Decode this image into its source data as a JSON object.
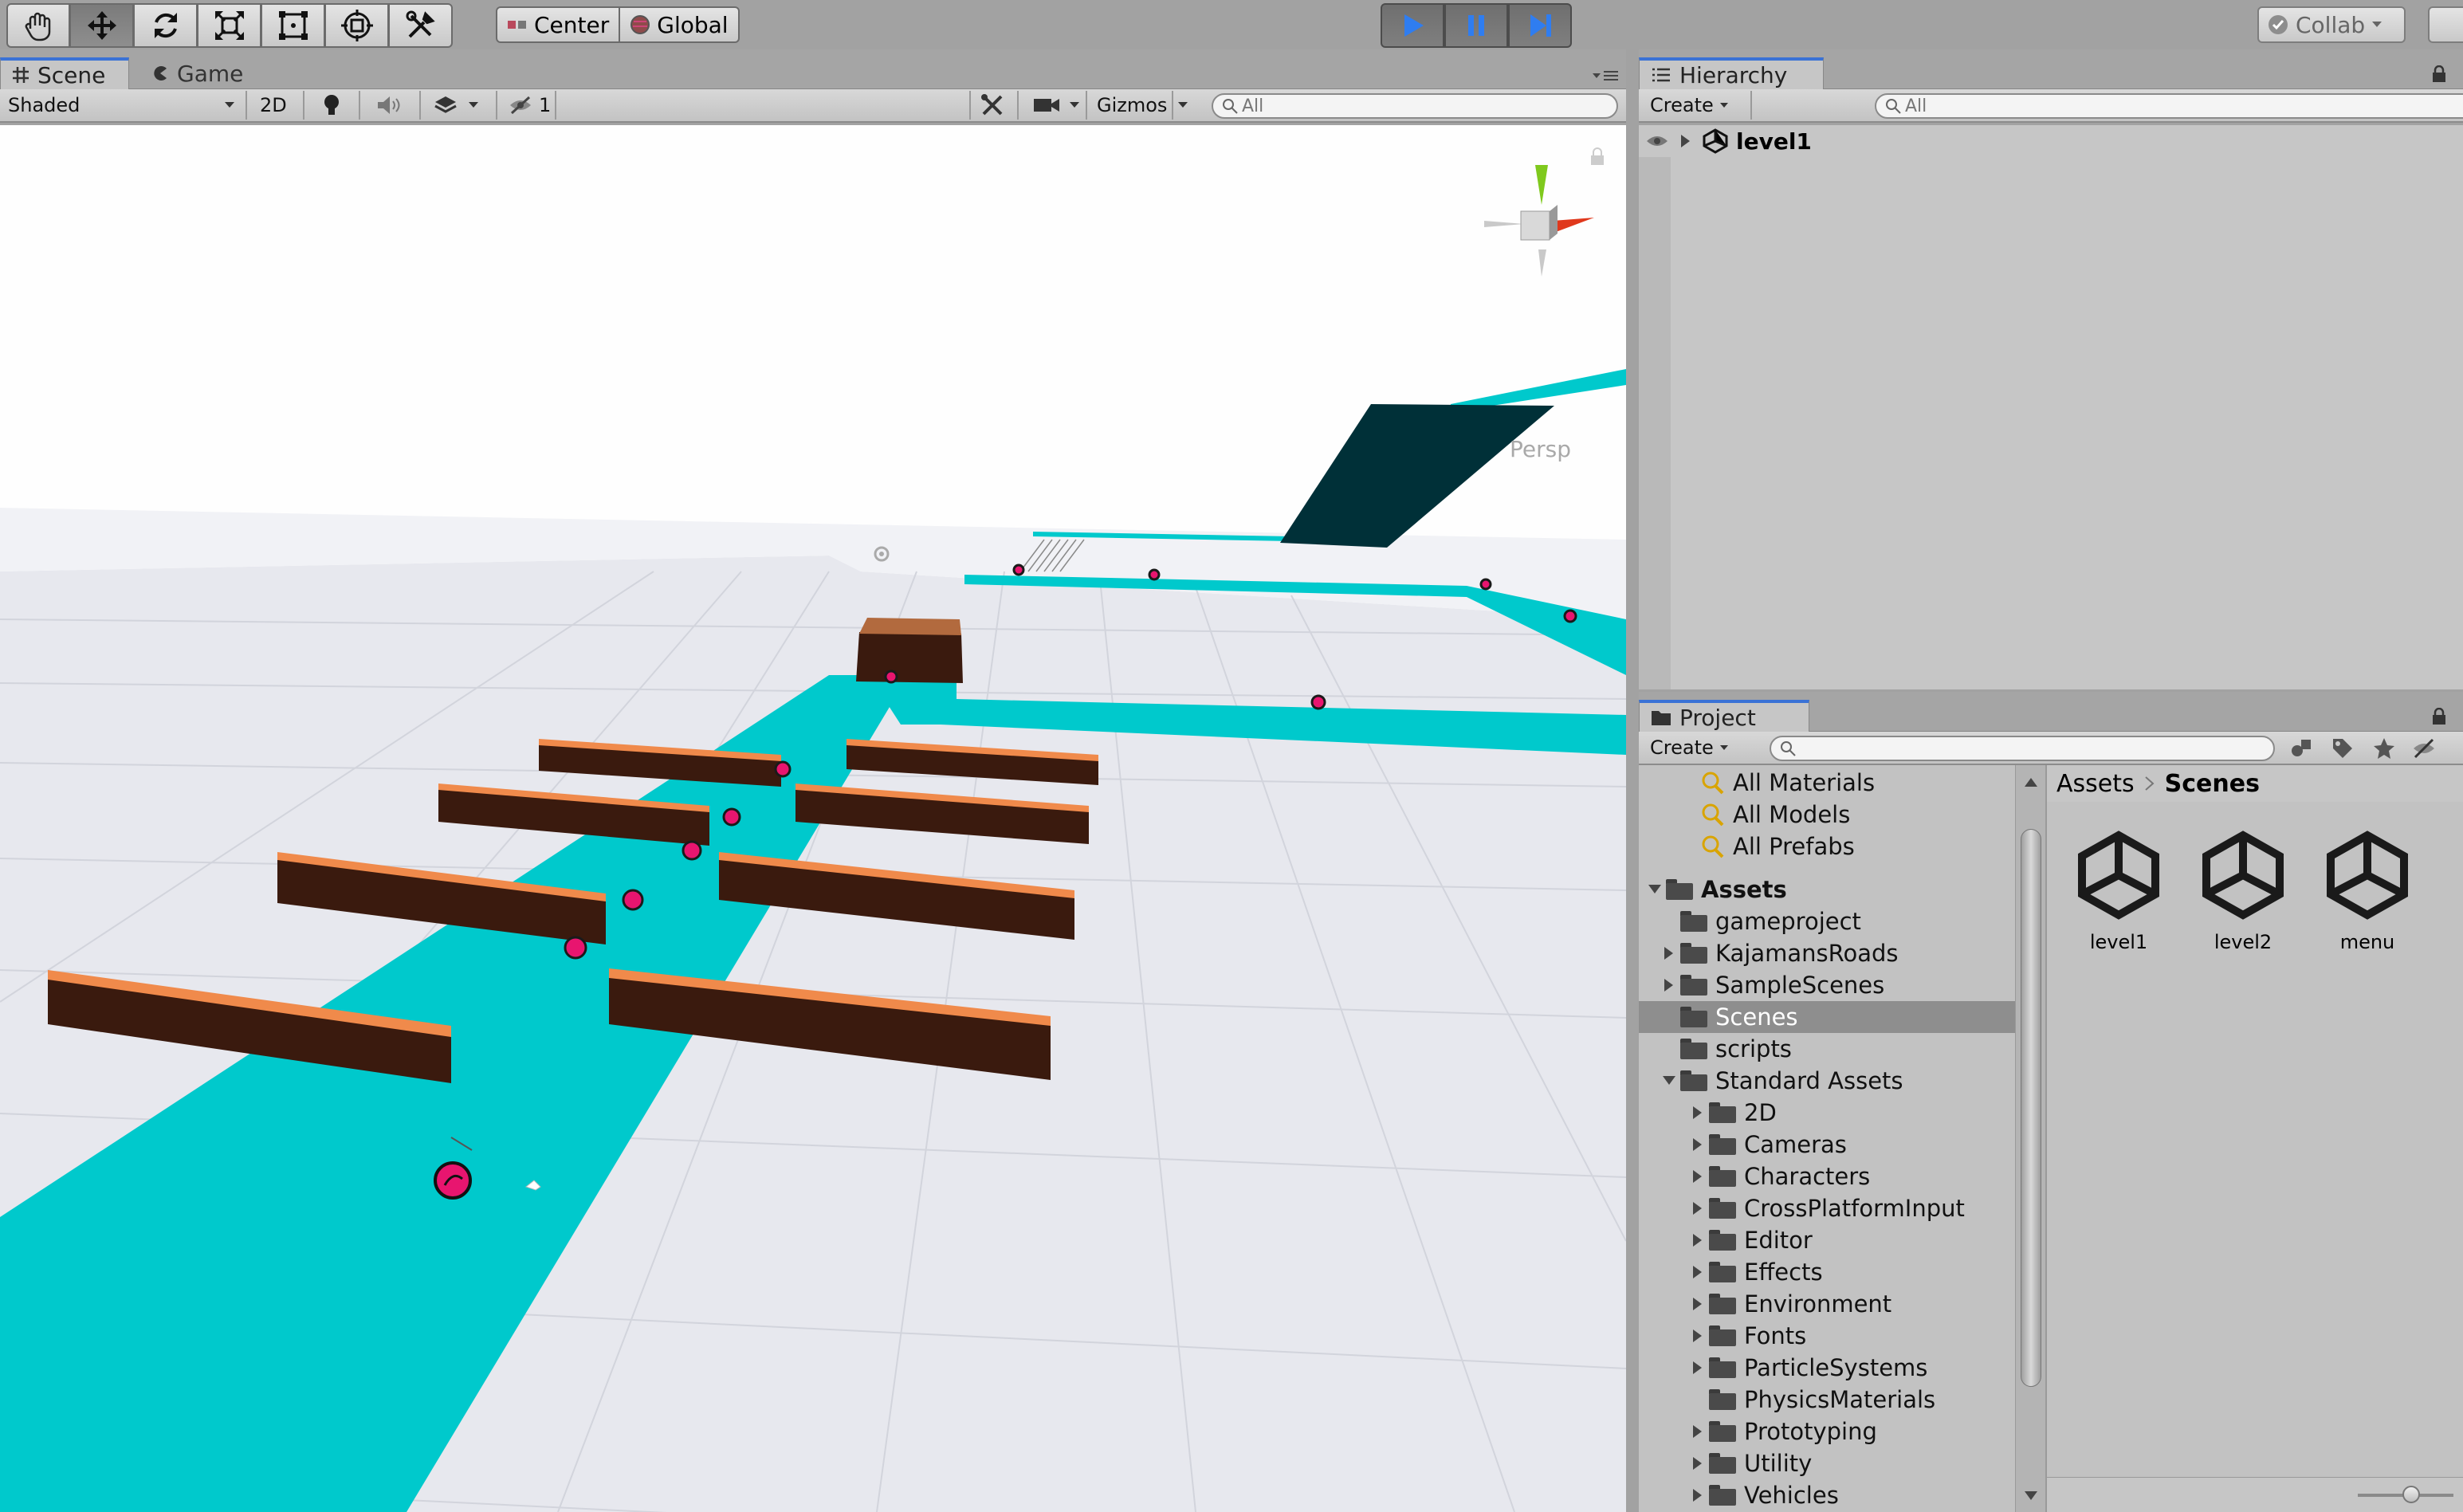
{
  "toolbar": {
    "tools": [
      "hand-icon",
      "move-icon",
      "rotate-icon",
      "scale-icon",
      "rect-icon",
      "transform-icon",
      "custom-tool-icon"
    ],
    "active_tool": 1,
    "pivot_mode": "Center",
    "pivot_rotation": "Global",
    "collab_label": "Collab"
  },
  "scene_panel": {
    "tabs": [
      {
        "label": "Scene",
        "icon": "grid-icon"
      },
      {
        "label": "Game",
        "icon": "pacman-icon"
      }
    ],
    "shading_mode": "Shaded",
    "mode_2d": "2D",
    "hidden_count": "1",
    "gizmos_label": "Gizmos",
    "search_placeholder": "All",
    "persp_label": "Persp"
  },
  "hierarchy_panel": {
    "title": "Hierarchy",
    "create_label": "Create",
    "search_placeholder": "All",
    "scene_name": "level1"
  },
  "project_panel": {
    "title": "Project",
    "create_label": "Create",
    "search_placeholder": "",
    "favorites": [
      "All Materials",
      "All Models",
      "All Prefabs"
    ],
    "assets_label": "Assets",
    "tree": [
      {
        "label": "gameproject",
        "depth": 1,
        "arrow": ""
      },
      {
        "label": "KajamansRoads",
        "depth": 1,
        "arrow": "right"
      },
      {
        "label": "SampleScenes",
        "depth": 1,
        "arrow": "right"
      },
      {
        "label": "Scenes",
        "depth": 1,
        "arrow": "",
        "selected": true
      },
      {
        "label": "scripts",
        "depth": 1,
        "arrow": ""
      },
      {
        "label": "Standard Assets",
        "depth": 1,
        "arrow": "down"
      },
      {
        "label": "2D",
        "depth": 2,
        "arrow": "right"
      },
      {
        "label": "Cameras",
        "depth": 2,
        "arrow": "right"
      },
      {
        "label": "Characters",
        "depth": 2,
        "arrow": "right"
      },
      {
        "label": "CrossPlatformInput",
        "depth": 2,
        "arrow": "right"
      },
      {
        "label": "Editor",
        "depth": 2,
        "arrow": "right"
      },
      {
        "label": "Effects",
        "depth": 2,
        "arrow": "right"
      },
      {
        "label": "Environment",
        "depth": 2,
        "arrow": "right"
      },
      {
        "label": "Fonts",
        "depth": 2,
        "arrow": "right"
      },
      {
        "label": "ParticleSystems",
        "depth": 2,
        "arrow": "right"
      },
      {
        "label": "PhysicsMaterials",
        "depth": 2,
        "arrow": ""
      },
      {
        "label": "Prototyping",
        "depth": 2,
        "arrow": "right"
      },
      {
        "label": "Utility",
        "depth": 2,
        "arrow": "right"
      },
      {
        "label": "Vehicles",
        "depth": 2,
        "arrow": "right"
      }
    ],
    "breadcrumb": [
      "Assets",
      "Scenes"
    ],
    "scene_files": [
      "level1",
      "level2",
      "menu"
    ]
  },
  "colors": {
    "road": "#00c9cc",
    "beam_top": "#f08a4b",
    "beam_side": "#3a1a0e",
    "coin": "#e8156f",
    "ramp": "#003038",
    "play_accent": "#2f7df0"
  }
}
